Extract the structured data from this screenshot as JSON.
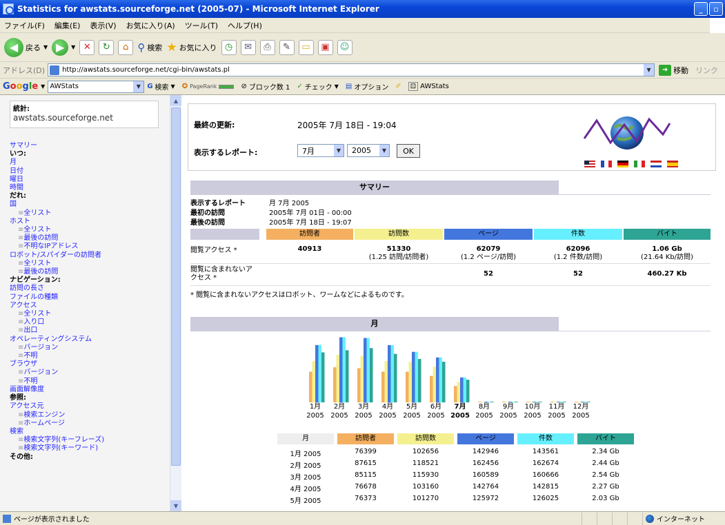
{
  "window": {
    "title": "Statistics for awstats.sourceforge.net (2005-07) - Microsoft Internet Explorer"
  },
  "menu": [
    "ファイル(F)",
    "編集(E)",
    "表示(V)",
    "お気に入り(A)",
    "ツール(T)",
    "ヘルプ(H)"
  ],
  "toolbar": {
    "back": "戻る",
    "search": "検索",
    "favorites": "お気に入り"
  },
  "address": {
    "label": "アドレス(D)",
    "url": "http://awstats.sourceforge.net/cgi-bin/awstats.pl",
    "go": "移動",
    "links": "リンク"
  },
  "google": {
    "logo": "Google",
    "query": "AWStats",
    "search": "検索",
    "pagerank": "PageRank",
    "blocked": "ブロック数 1",
    "check": "チェック",
    "options": "オプション",
    "awstats": "AWStats"
  },
  "left": {
    "stat_key": "統計:",
    "stat_val": "awstats.sourceforge.net",
    "nav": [
      {
        "t": "a",
        "label": "サマリー"
      },
      {
        "t": "h",
        "label": "いつ:"
      },
      {
        "t": "a",
        "label": "月"
      },
      {
        "t": "a",
        "label": "日付"
      },
      {
        "t": "a",
        "label": "曜日"
      },
      {
        "t": "a",
        "label": "時間"
      },
      {
        "t": "h",
        "label": "だれ:"
      },
      {
        "t": "a",
        "label": "国"
      },
      {
        "t": "s",
        "label": "全リスト"
      },
      {
        "t": "a",
        "label": "ホスト"
      },
      {
        "t": "s",
        "label": "全リスト"
      },
      {
        "t": "s",
        "label": "最後の訪問"
      },
      {
        "t": "s",
        "label": "不明なIPアドレス"
      },
      {
        "t": "a",
        "label": "ロボット/スパイダーの訪問者"
      },
      {
        "t": "s",
        "label": "全リスト"
      },
      {
        "t": "s",
        "label": "最後の訪問"
      },
      {
        "t": "h",
        "label": "ナビゲーション:"
      },
      {
        "t": "a",
        "label": "訪問の長さ"
      },
      {
        "t": "a",
        "label": "ファイルの種類"
      },
      {
        "t": "a",
        "label": "アクセス"
      },
      {
        "t": "s",
        "label": "全リスト"
      },
      {
        "t": "s",
        "label": "入り口"
      },
      {
        "t": "s",
        "label": "出口"
      },
      {
        "t": "a",
        "label": "オペレーティングシステム"
      },
      {
        "t": "s",
        "label": "バージョン"
      },
      {
        "t": "s",
        "label": "不明"
      },
      {
        "t": "a",
        "label": "ブラウザ"
      },
      {
        "t": "s",
        "label": "バージョン"
      },
      {
        "t": "s",
        "label": "不明"
      },
      {
        "t": "a",
        "label": "画面解像度"
      },
      {
        "t": "h",
        "label": "参照:"
      },
      {
        "t": "a",
        "label": "アクセス元"
      },
      {
        "t": "s",
        "label": "検索エンジン"
      },
      {
        "t": "s",
        "label": "ホームページ"
      },
      {
        "t": "a",
        "label": "検索"
      },
      {
        "t": "s",
        "label": "検索文字列(キーフレーズ)"
      },
      {
        "t": "s",
        "label": "検索文字列(キーワード)"
      },
      {
        "t": "h",
        "label": "その他:"
      }
    ]
  },
  "header": {
    "updated_label": "最終の更新:",
    "updated_value": "2005年 7月 18日 - 19:04",
    "report_label": "表示するレポート:",
    "month_select": "7月",
    "year_select": "2005",
    "ok": "OK"
  },
  "summary": {
    "title": "サマリー",
    "rows": [
      {
        "k": "表示するレポート",
        "v": "月 7月 2005"
      },
      {
        "k": "最初の訪問",
        "v": "2005年 7月 01日 - 00:00"
      },
      {
        "k": "最後の訪問",
        "v": "2005年 7月 18日 - 19:07"
      }
    ],
    "cols": [
      "訪問者",
      "訪問数",
      "ページ",
      "件数",
      "バイト"
    ],
    "row1_label": "閲覧アクセス *",
    "row1": [
      {
        "v": "40913",
        "s": ""
      },
      {
        "v": "51330",
        "s": "(1.25 訪問/訪問者)"
      },
      {
        "v": "62079",
        "s": "(1.2 ページ/訪問)"
      },
      {
        "v": "62096",
        "s": "(1.2 件数/訪問)"
      },
      {
        "v": "1.06 Gb",
        "s": "(21.64 Kb/訪問)"
      }
    ],
    "row2_label_1": "閲覧に含まれないア",
    "row2_label_2": "クセス *",
    "row2": [
      "",
      "",
      "52",
      "52",
      "460.27 Kb"
    ],
    "note": "* 閲覧に含まれないアクセスはロボット、ワームなどによるものです。"
  },
  "month": {
    "title": "月",
    "labels": [
      "1月",
      "2月",
      "3月",
      "4月",
      "5月",
      "6月",
      "7月",
      "8月",
      "9月",
      "10月",
      "11月",
      "12月"
    ],
    "years": [
      "2005",
      "2005",
      "2005",
      "2005",
      "2005",
      "2005",
      "2005",
      "2005",
      "2005",
      "2005",
      "2005",
      "2005"
    ],
    "current_index": 6,
    "colors": {
      "visitors": "#f4b060",
      "visits": "#f4f090",
      "pages": "#4477dd",
      "hits": "#66f0ff",
      "bytes": "#2ea495"
    },
    "cols": [
      "月",
      "訪問者",
      "訪問数",
      "ページ",
      "件数",
      "バイト"
    ],
    "rows": [
      [
        "1月 2005",
        "76399",
        "102656",
        "142946",
        "143561",
        "2.34 Gb"
      ],
      [
        "2月 2005",
        "87615",
        "118521",
        "162456",
        "162674",
        "2.44 Gb"
      ],
      [
        "3月 2005",
        "85115",
        "115930",
        "160589",
        "160666",
        "2.54 Gb"
      ],
      [
        "4月 2005",
        "76678",
        "103160",
        "142764",
        "142815",
        "2.27 Gb"
      ],
      [
        "5月 2005",
        "76373",
        "101270",
        "125972",
        "126025",
        "2.03 Gb"
      ]
    ]
  },
  "chart_data": {
    "type": "bar",
    "categories": [
      "1月",
      "2月",
      "3月",
      "4月",
      "5月",
      "6月",
      "7月",
      "8月",
      "9月",
      "10月",
      "11月",
      "12月"
    ],
    "series": [
      {
        "name": "訪問者",
        "values": [
          76399,
          87615,
          85115,
          76678,
          76373,
          66000,
          40913,
          0,
          0,
          0,
          0,
          0
        ]
      },
      {
        "name": "訪問数",
        "values": [
          102656,
          118521,
          115930,
          103160,
          101270,
          89000,
          51330,
          0,
          0,
          0,
          0,
          0
        ]
      },
      {
        "name": "ページ",
        "values": [
          142946,
          162456,
          160589,
          142764,
          125972,
          112000,
          62079,
          0,
          0,
          0,
          0,
          0
        ]
      },
      {
        "name": "件数",
        "values": [
          143561,
          162674,
          160666,
          142815,
          126025,
          112100,
          62096,
          0,
          0,
          0,
          0,
          0
        ]
      },
      {
        "name": "バイト",
        "values": [
          2.34,
          2.44,
          2.54,
          2.27,
          2.03,
          1.9,
          1.06,
          0,
          0,
          0,
          0,
          0
        ]
      }
    ]
  },
  "status": {
    "text": "ページが表示されました",
    "zone": "インターネット"
  }
}
